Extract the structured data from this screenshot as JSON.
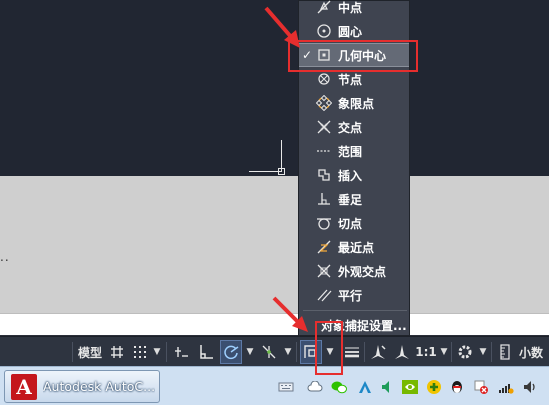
{
  "canvas": {
    "command_dots": ".."
  },
  "snap_menu": {
    "items": [
      {
        "label": "中点",
        "icon": "midpoint-icon",
        "checked": false
      },
      {
        "label": "圆心",
        "icon": "center-icon",
        "checked": false
      },
      {
        "label": "几何中心",
        "icon": "geometric-center-icon",
        "checked": true
      },
      {
        "label": "节点",
        "icon": "node-icon",
        "checked": false
      },
      {
        "label": "象限点",
        "icon": "quadrant-icon",
        "checked": false
      },
      {
        "label": "交点",
        "icon": "intersection-icon",
        "checked": false
      },
      {
        "label": "范围",
        "icon": "extension-icon",
        "checked": false
      },
      {
        "label": "插入",
        "icon": "insertion-icon",
        "checked": false
      },
      {
        "label": "垂足",
        "icon": "perpendicular-icon",
        "checked": false
      },
      {
        "label": "切点",
        "icon": "tangent-icon",
        "checked": false
      },
      {
        "label": "最近点",
        "icon": "nearest-icon",
        "checked": false
      },
      {
        "label": "外观交点",
        "icon": "apparent-intersection-icon",
        "checked": false
      },
      {
        "label": "平行",
        "icon": "parallel-icon",
        "checked": false
      }
    ],
    "check_mark": "✓",
    "settings_label": "对象捕捉设置..."
  },
  "statusbar": {
    "model_label": "模型",
    "scale_label": "1:1",
    "units_label": "小数"
  },
  "taskbar": {
    "app_label": "Autodesk AutoC...",
    "app_logo_letter": "A"
  },
  "colors": {
    "accent_red": "#e62e2e",
    "menu_bg": "#3f4450",
    "statusbar_bg": "#2e3440",
    "canvas_dark": "#212632"
  }
}
